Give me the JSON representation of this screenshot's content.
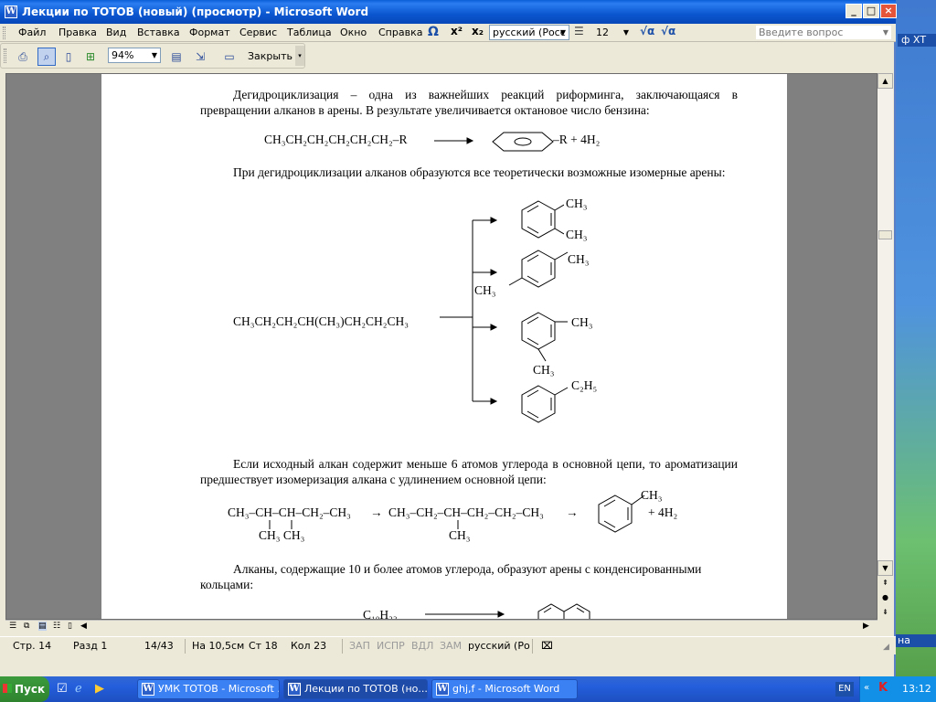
{
  "window": {
    "title": "Лекции по ТОТОВ (новый) (просмотр) - Microsoft Word",
    "word_icon": "W"
  },
  "menu": {
    "items": [
      "Файл",
      "Правка",
      "Вид",
      "Вставка",
      "Формат",
      "Сервис",
      "Таблица",
      "Окно",
      "Справка"
    ],
    "omega_icon": "Ω",
    "superscript_icon": "x²",
    "subscript_icon": "x₂",
    "language_value": "русский (Росс",
    "font_size_value": "12",
    "help_placeholder": "Введите вопрос"
  },
  "toolbar": {
    "zoom_value": "94%",
    "close_label": "Закрыть"
  },
  "document": {
    "para1": "Дегидроциклизация – одна из важнейших реакций риформинга, заключающаяся в превращении алканов в арены. В результате увеличивается октановое число бензина:",
    "eq1_left": "CH₃CH₂CH₂CH₂CH₂CH₂–R",
    "eq1_right": "–R  + 4H₂",
    "para2": "При дегидроциклизации алканов образуются все теоретически возможные изомерные арены:",
    "isomer_reactant": "CH₃CH₂CH₂CH(CH₃)CH₂CH₂CH₃",
    "ch3": "CH₃",
    "c2h5": "C₂H₅",
    "para3": "Если исходный алкан содержит меньше 6 атомов углерода в основной цепи, то ароматизации предшествует изомеризация алкана с удлинением основной цепи:",
    "eq3_chain1": "CH₃–CH–CH–CH₂–CH₃",
    "eq3_arrow1": "→",
    "eq3_chain2": "CH₃–CH₂–CH–CH₂–CH₂–CH₃",
    "eq3_arrow2": "→",
    "eq3_sub1": "CH₃ CH₃",
    "eq3_sub2": "CH₃",
    "eq3_plus": "+   4H₂",
    "para4": "Алканы, содержащие 10 и более атомов углерода, образуют арены с конденсированными кольцами:",
    "eq4_left": "C₁₀H₂₂"
  },
  "status": {
    "page": "Стр. 14",
    "section": "Разд 1",
    "pages": "14/43",
    "position": "На 10,5см",
    "line": "Ст 18",
    "column": "Кол 23",
    "rec": "ЗАП",
    "track": "ИСПР",
    "ext": "ВДЛ",
    "ovr": "ЗАМ",
    "language": "русский (Ро"
  },
  "taskbar": {
    "start_label": "Пуск",
    "tasks": [
      "УМК ТОТОВ - Microsoft ...",
      "Лекции по ТОТОВ (но...",
      "ghj,f - Microsoft Word"
    ],
    "lang": "EN",
    "clock": "13:12"
  },
  "desktop": {
    "label_top": "ф ХТ",
    "label_bottom": "на"
  }
}
